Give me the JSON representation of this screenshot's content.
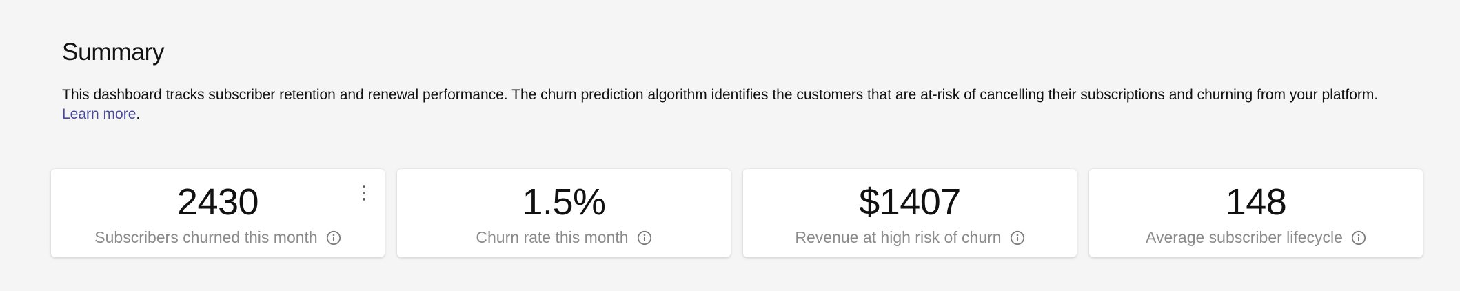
{
  "summary": {
    "title": "Summary",
    "description": "This dashboard tracks subscriber retention and renewal performance. The churn prediction algorithm identifies the customers that are at-risk of cancelling their subscriptions and churning from your platform.",
    "learn_more_label": "Learn more",
    "learn_more_suffix": "."
  },
  "cards": [
    {
      "value": "2430",
      "label": "Subscribers churned this month",
      "icon": "info-icon"
    },
    {
      "value": "1.5%",
      "label": "Churn rate this month",
      "icon": "info-icon"
    },
    {
      "value": "$1407",
      "label": "Revenue at high risk of churn",
      "icon": "info-icon"
    },
    {
      "value": "148",
      "label": "Average subscriber lifecycle",
      "icon": "info-icon"
    }
  ],
  "colors": {
    "background": "#f5f5f5",
    "link": "#4a4a9c",
    "label": "#8a8a8a",
    "card": "#ffffff"
  }
}
